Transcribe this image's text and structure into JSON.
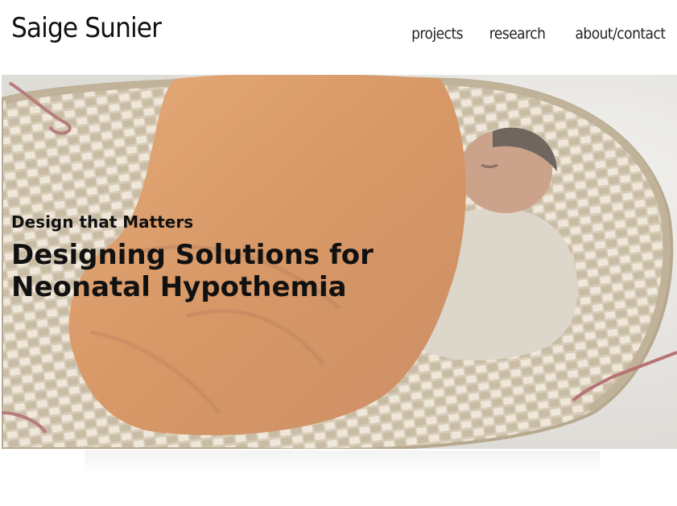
{
  "header": {
    "site_title": "Saige Sunier",
    "nav": {
      "projects": "projects",
      "research": "research",
      "about": "about/contact"
    }
  },
  "hero": {
    "kicker": "Design that Matters",
    "title_line1": "Designing Solutions for",
    "title_line2": "Neonatal Hypothemia"
  }
}
